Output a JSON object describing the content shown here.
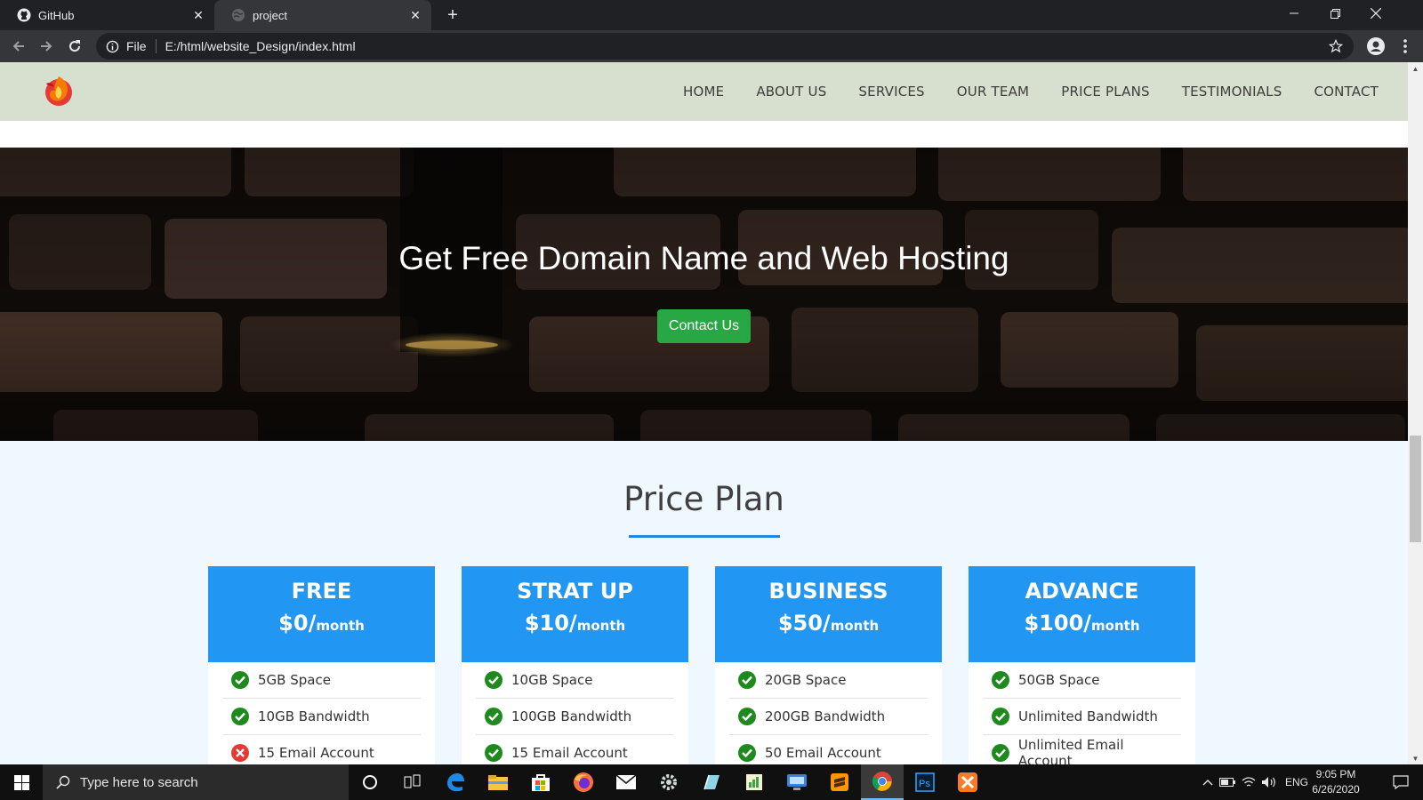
{
  "browser": {
    "tabs": [
      {
        "title": "GitHub",
        "icon": "github-icon",
        "active": false
      },
      {
        "title": "project",
        "icon": "globe-icon",
        "active": true
      }
    ],
    "address": {
      "scheme_label": "File",
      "url": "E:/html/website_Design/index.html"
    }
  },
  "site": {
    "nav": [
      "HOME",
      "ABOUT US",
      "SERVICES",
      "OUR TEAM",
      "PRICE PLANS",
      "TESTIMONIALS",
      "CONTACT"
    ],
    "hero": {
      "heading": "Get Free Domain Name and Web Hosting",
      "cta_label": "Contact Us"
    },
    "pricing": {
      "title": "Price Plan",
      "plans": [
        {
          "name": "FREE",
          "price": "$0/",
          "period": "month",
          "features": [
            {
              "text": "5GB Space",
              "included": true
            },
            {
              "text": "10GB Bandwidth",
              "included": true
            },
            {
              "text": "15 Email Account",
              "included": false
            }
          ]
        },
        {
          "name": "STRAT UP",
          "price": "$10/",
          "period": "month",
          "features": [
            {
              "text": "10GB Space",
              "included": true
            },
            {
              "text": "100GB Bandwidth",
              "included": true
            },
            {
              "text": "15 Email Account",
              "included": true
            }
          ]
        },
        {
          "name": "BUSINESS",
          "price": "$50/",
          "period": "month",
          "features": [
            {
              "text": "20GB Space",
              "included": true
            },
            {
              "text": "200GB Bandwidth",
              "included": true
            },
            {
              "text": "50 Email Account",
              "included": true
            }
          ]
        },
        {
          "name": "ADVANCE",
          "price": "$100/",
          "period": "month",
          "features": [
            {
              "text": "50GB Space",
              "included": true
            },
            {
              "text": "Unlimited Bandwidth",
              "included": true
            },
            {
              "text": "Unlimited Email Account",
              "included": true
            }
          ]
        }
      ]
    }
  },
  "taskbar": {
    "search_placeholder": "Type here to search",
    "apps": [
      "cortana-icon",
      "task-view-icon",
      "edge-icon",
      "file-explorer-icon",
      "store-icon",
      "firefox-icon",
      "mail-icon",
      "settings-icon",
      "notepad-icon",
      "spreadsheet-icon",
      "network-icon",
      "sublime-text-icon",
      "chrome-icon",
      "photoshop-icon",
      "xampp-icon"
    ],
    "active_app": "chrome-icon",
    "language": "ENG",
    "time": "9:05 PM",
    "date": "6/26/2020"
  },
  "colors": {
    "nav_bg": "#d7dfce",
    "plan_header": "#2196f3",
    "cta": "#28a745",
    "check": "#1e8a1e",
    "cross": "#e53935"
  }
}
